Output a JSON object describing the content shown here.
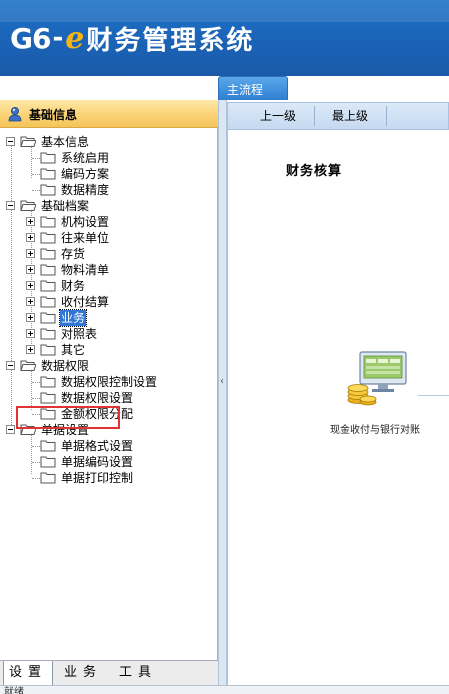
{
  "app": {
    "brand_prefix": "G6",
    "brand_dash": "-",
    "brand_e": "e",
    "brand_title": "财务管理系统"
  },
  "tabs": {
    "main": "主流程"
  },
  "left_panel": {
    "title": "基础信息",
    "tree": {
      "basic_info": "基本信息",
      "system_enable": "系统启用",
      "coding_scheme": "编码方案",
      "data_precision": "数据精度",
      "base_archive": "基础档案",
      "org_setup": "机构设置",
      "contacts": "往来单位",
      "inventory": "存货",
      "bom": "物料清单",
      "finance": "财务",
      "payment_settlement": "收付结算",
      "business": "业务",
      "mapping_table": "对照表",
      "other": "其它",
      "data_permission": "数据权限",
      "data_perm_control": "数据权限控制设置",
      "data_perm_setup": "数据权限设置",
      "amount_perm": "金额权限分配",
      "doc_setup": "单据设置",
      "doc_format": "单据格式设置",
      "doc_numbering": "单据编码设置",
      "doc_print": "单据打印控制"
    },
    "bottom_tabs": [
      "设置",
      "业务",
      "工具"
    ]
  },
  "toolbar": {
    "up_one": "上一级",
    "top_level": "最上级"
  },
  "content": {
    "section_title": "财务核算",
    "flow_item_label": "现金收付与银行对账"
  },
  "status": {
    "text": "就绪"
  },
  "colors": {
    "header_blue": "#1b63b6",
    "selection_blue": "#3178d6",
    "highlight_red": "#e23333",
    "accent_gold": "#f5b514"
  }
}
